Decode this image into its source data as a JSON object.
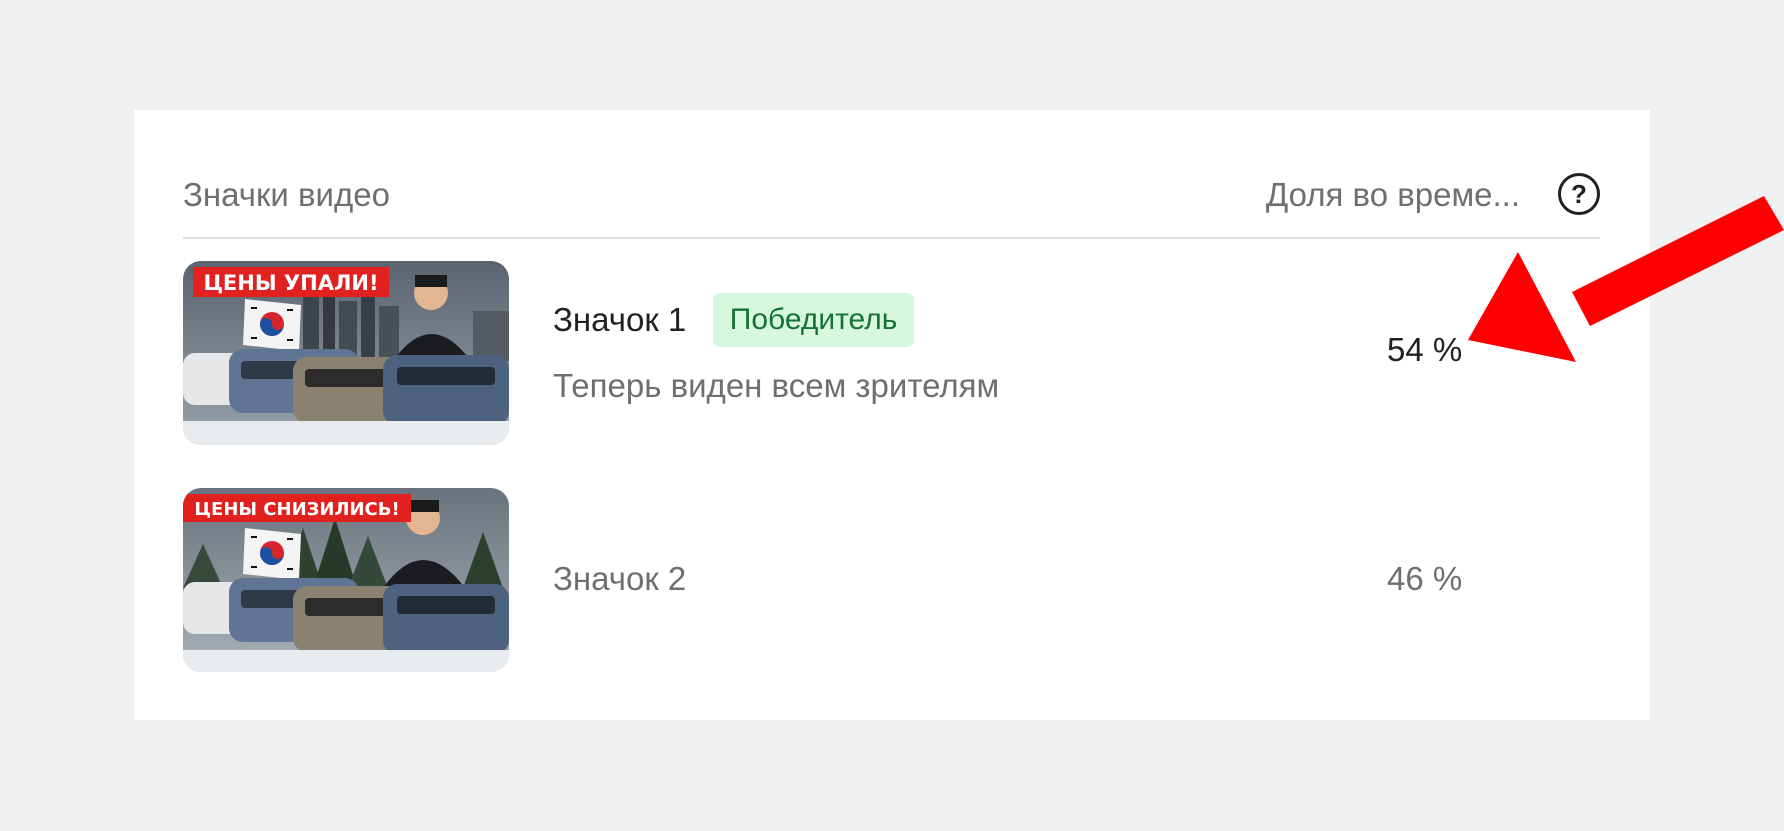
{
  "header": {
    "left_label": "Значки видео",
    "right_label": "Доля во време...",
    "help_symbol": "?"
  },
  "rows": [
    {
      "thumbnail_text": "ЦЕНЫ УПАЛИ!",
      "name": "Значок 1",
      "badge": "Победитель",
      "subtitle": "Теперь виден всем зрителям",
      "share": "54 %"
    },
    {
      "thumbnail_text": "ЦЕНЫ СНИЗИЛИСЬ!",
      "name": "Значок 2",
      "share": "46 %"
    }
  ],
  "colors": {
    "badge_background": "#d8f8de",
    "badge_text": "#137333",
    "annotation_arrow": "#ff0000"
  },
  "icons": [
    "help-icon",
    "arrow-icon"
  ]
}
